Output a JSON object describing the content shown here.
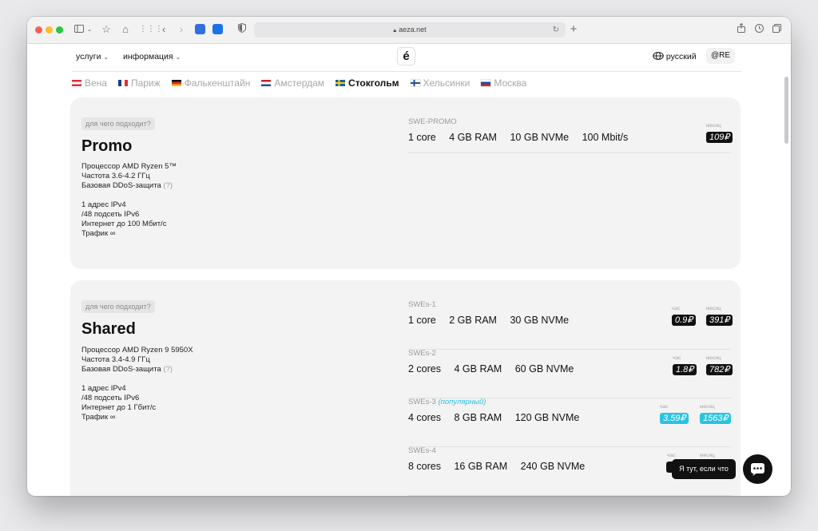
{
  "browser": {
    "url": "aeza.net",
    "traffic_lights": [
      "#fe5f57",
      "#febc2e",
      "#28c840"
    ]
  },
  "header": {
    "menu_services": "услуги",
    "menu_info": "информация",
    "logo": "é",
    "language": "русский",
    "account": "@RE"
  },
  "cities": [
    {
      "name": "Вена",
      "active": false
    },
    {
      "name": "Париж",
      "active": false
    },
    {
      "name": "Фалькенштайн",
      "active": false
    },
    {
      "name": "Амстердам",
      "active": false
    },
    {
      "name": "Стокгольм",
      "active": true
    },
    {
      "name": "Хельсинки",
      "active": false
    },
    {
      "name": "Москва",
      "active": false
    }
  ],
  "promo": {
    "pill": "для чего подходит?",
    "title": "Promo",
    "spec_cpu": "Процессор AMD Ryzen 5™",
    "spec_freq": "Частота 3.6-4.2 ГГц",
    "spec_ddos": "Базовая DDoS-защита",
    "spec_ddos_q": "(?)",
    "net_ip": "1 адрес IPv4",
    "net_subnet": "/48 подсеть IPv6",
    "net_speed": "Интернет до 100 Мбит/с",
    "net_traffic": "Трафик ∞",
    "plan": {
      "name": "SWE-PROMO",
      "cpu": "1 core",
      "ram": "4 GB RAM",
      "disk": "10 GB NVMe",
      "port": "100 Mbit/s",
      "month_label": "месяц",
      "month_price": "109₽"
    }
  },
  "shared": {
    "pill": "для чего подходит?",
    "title": "Shared",
    "spec_cpu": "Процессор AMD Ryzen 9 5950X",
    "spec_freq": "Частота 3.4-4.9 ГГц",
    "spec_ddos": "Базовая DDoS-защита",
    "spec_ddos_q": "(?)",
    "net_ip": "1 адрес IPv4",
    "net_subnet": "/48 подсеть IPv6",
    "net_speed": "Интернет до 1 Гбит/с",
    "net_traffic": "Трафик ∞",
    "hour_label": "час",
    "month_label": "месяц",
    "plans": [
      {
        "name": "SWEs-1",
        "cpu": "1 core",
        "ram": "2 GB RAM",
        "disk": "30 GB NVMe",
        "hour": "0.9₽",
        "month": "391₽"
      },
      {
        "name": "SWEs-2",
        "cpu": "2 cores",
        "ram": "4 GB RAM",
        "disk": "60 GB NVMe",
        "hour": "1.8₽",
        "month": "782₽"
      },
      {
        "name": "SWEs-3",
        "popular": "(популярный)",
        "cpu": "4 cores",
        "ram": "8 GB RAM",
        "disk": "120 GB NVMe",
        "hour": "3.59₽",
        "month": "1563₽"
      },
      {
        "name": "SWEs-4",
        "cpu": "8 cores",
        "ram": "16 GB RAM",
        "disk": "240 GB NVMe",
        "hour": "",
        "month": ""
      }
    ]
  },
  "chat": {
    "tooltip": "Я тут, если что"
  },
  "colors": {
    "accent_blue": "#2bc3e2",
    "price_black": "#111111",
    "card_bg": "#f3f3f3"
  }
}
